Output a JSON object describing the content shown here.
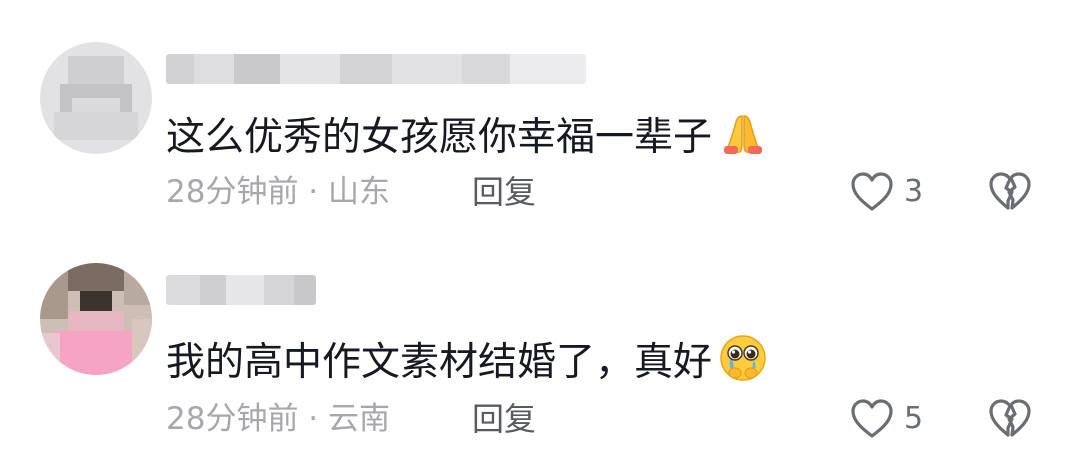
{
  "comments": [
    {
      "text": "这么优秀的女孩愿你幸福一辈子",
      "emoji": "folded-hands",
      "time": "28分钟前",
      "separator": " · ",
      "location": "山东",
      "reply_label": "回复",
      "like_count": "3"
    },
    {
      "text": "我的高中作文素材结婚了，真好",
      "emoji": "pleading-face",
      "time": "28分钟前",
      "separator": " · ",
      "location": "云南",
      "reply_label": "回复",
      "like_count": "5"
    }
  ],
  "icons": {
    "like": "heart-outline-icon",
    "dislike": "broken-heart-icon"
  },
  "colors": {
    "text": "#161823",
    "meta": "#a7a7ac",
    "reply": "#595b63",
    "icon": "#6b6d75"
  }
}
